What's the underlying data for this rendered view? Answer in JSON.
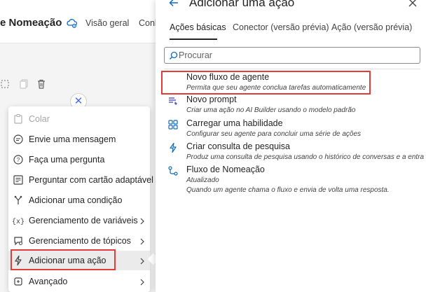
{
  "app": {
    "flow_title": "e Nomeação",
    "nav": {
      "overview": "Visão geral",
      "connections": "Conh"
    }
  },
  "context_menu": {
    "items": [
      {
        "label": "Colar",
        "icon": "paste-icon",
        "disabled": true
      },
      {
        "label": "Envie uma mensagem",
        "icon": "message-icon"
      },
      {
        "label": "Faça uma pergunta",
        "icon": "question-icon"
      },
      {
        "label": "Perguntar com cartão adaptável",
        "icon": "adaptive-card-icon"
      },
      {
        "label": "Adicionar uma condição",
        "icon": "condition-icon"
      },
      {
        "label": "Gerenciamento de variáveis",
        "icon": "variable-icon",
        "submenu": true
      },
      {
        "label": "Gerenciamento de tópicos",
        "icon": "topic-icon",
        "submenu": true
      },
      {
        "label": "Adicionar uma ação",
        "icon": "action-icon",
        "submenu": true,
        "active": true
      },
      {
        "label": "Avançado",
        "icon": "advanced-icon",
        "submenu": true
      }
    ]
  },
  "panel": {
    "title": "Adicionar uma ação",
    "tabs": [
      {
        "label": "Ações básicas",
        "selected": true
      },
      {
        "label": "Conector (versão prévia)",
        "selected": false
      },
      {
        "label": "Ação (versão prévia)",
        "selected": false
      }
    ],
    "search": {
      "placeholder": "Procurar",
      "value": ""
    },
    "actions": [
      {
        "title": "Novo fluxo de agente",
        "subtitle": "Permita que seu agente conclua tarefas automaticamente",
        "icon": "agent-flow-icon"
      },
      {
        "title": "Novo prompt",
        "subtitle": "Criar uma ação no AI Builder usando o modelo padrão",
        "icon": "prompt-icon"
      },
      {
        "title": "Carregar uma habilidade",
        "subtitle": "Configurar seu agente para concluir uma série de ações",
        "icon": "skill-icon"
      },
      {
        "title": "Criar consulta de pesquisa",
        "subtitle": "Produz uma consulta de pesquisa usando o histórico de conversas e a entra",
        "icon": "search-query-icon"
      },
      {
        "title": "Fluxo de Nomeação",
        "subtitle": "Atualizado",
        "subtitle2": "Quando um agente chama o fluxo e envia de volta uma resposta.",
        "icon": "flow-icon"
      }
    ]
  },
  "colors": {
    "highlight_border": "#e23b3b",
    "accent": "#4f6bed",
    "flow_icon": "#0f6cbd"
  }
}
